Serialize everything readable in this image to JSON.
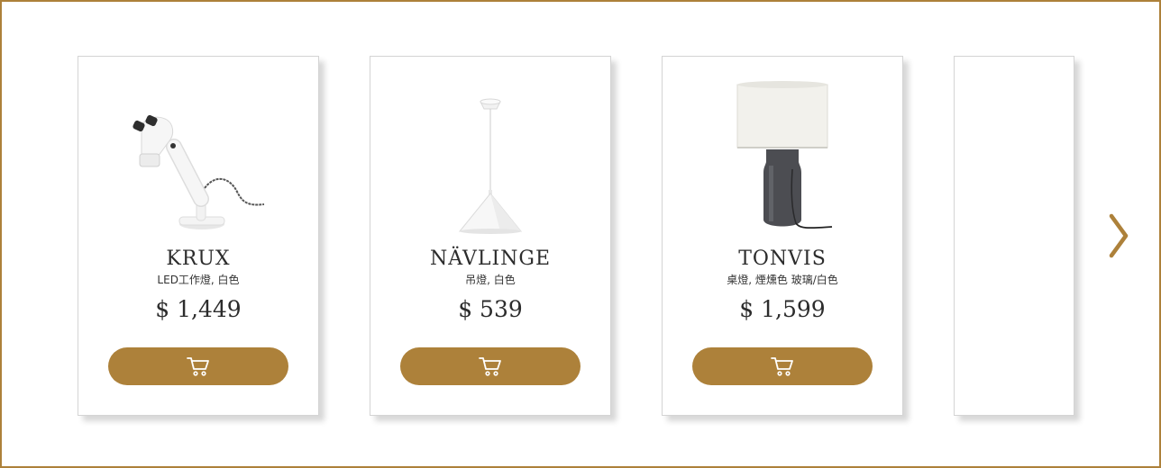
{
  "products": [
    {
      "name": "KRUX",
      "description": "LED工作燈, 白色",
      "price": "$ 1,449",
      "image_icon": "desk-lamp-icon",
      "cart_icon": "cart-icon"
    },
    {
      "name": "NÄVLINGE",
      "description": "吊燈, 白色",
      "price": "$ 539",
      "image_icon": "pendant-lamp-icon",
      "cart_icon": "cart-icon"
    },
    {
      "name": "TONVIS",
      "description": "桌燈, 煙燻色 玻璃/白色",
      "price": "$ 1,599",
      "image_icon": "table-lamp-icon",
      "cart_icon": "cart-icon"
    }
  ],
  "navigation": {
    "next_icon": "chevron-right-icon"
  },
  "colors": {
    "accent": "#ad813a",
    "border": "#ad813a",
    "card_border": "#d4d4d4",
    "text": "#2c2c2c"
  }
}
